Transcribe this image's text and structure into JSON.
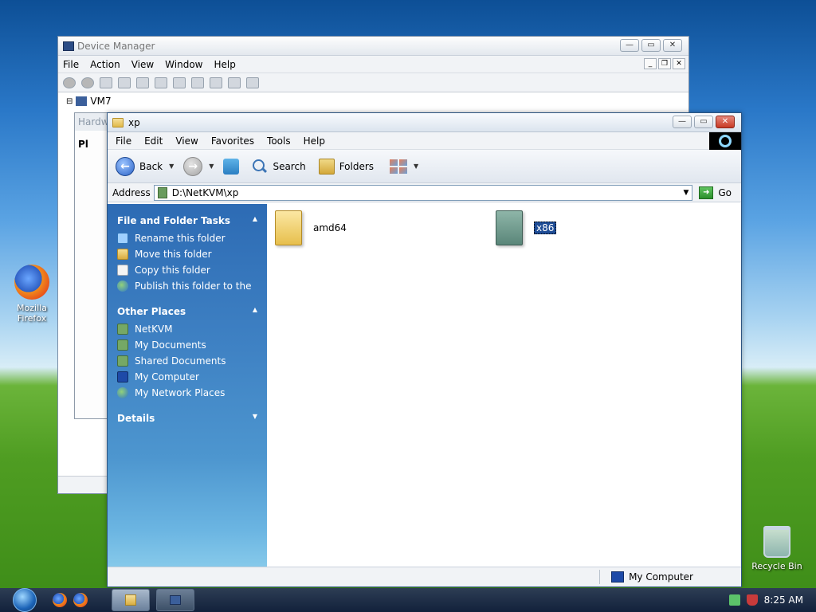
{
  "desktop": {
    "icons": [
      {
        "label": "Mozilla Firefox"
      },
      {
        "label": "Recycle Bin"
      }
    ]
  },
  "device_manager": {
    "title": "Device Manager",
    "menu": [
      "File",
      "Action",
      "View",
      "Window",
      "Help"
    ],
    "tree_root": "VM7",
    "hardware_title": "Hardw",
    "hardware_text": "Pl"
  },
  "explorer": {
    "title": "xp",
    "menu": [
      "File",
      "Edit",
      "View",
      "Favorites",
      "Tools",
      "Help"
    ],
    "toolbar": {
      "back": "Back",
      "search": "Search",
      "folders": "Folders"
    },
    "address": {
      "label": "Address",
      "value": "D:\\NetKVM\\xp",
      "go": "Go"
    },
    "tasks": {
      "file_folder_tasks": {
        "title": "File and Folder Tasks",
        "items": [
          {
            "label": "Rename this folder",
            "icon": "rename-icon"
          },
          {
            "label": "Move this folder",
            "icon": "move-icon"
          },
          {
            "label": "Copy this folder",
            "icon": "copy-icon"
          },
          {
            "label": "Publish this folder to the",
            "icon": "publish-icon"
          }
        ]
      },
      "other_places": {
        "title": "Other Places",
        "items": [
          {
            "label": "NetKVM",
            "icon": "drive-icon"
          },
          {
            "label": "My Documents",
            "icon": "documents-icon"
          },
          {
            "label": "Shared Documents",
            "icon": "shared-documents-icon"
          },
          {
            "label": "My Computer",
            "icon": "computer-icon"
          },
          {
            "label": "My Network Places",
            "icon": "network-icon"
          }
        ]
      },
      "details": {
        "title": "Details"
      }
    },
    "files": [
      {
        "name": "amd64",
        "selected": false
      },
      {
        "name": "x86",
        "selected": true
      }
    ],
    "status": {
      "location": "My Computer"
    }
  },
  "taskbar": {
    "clock": "8:25 AM"
  }
}
